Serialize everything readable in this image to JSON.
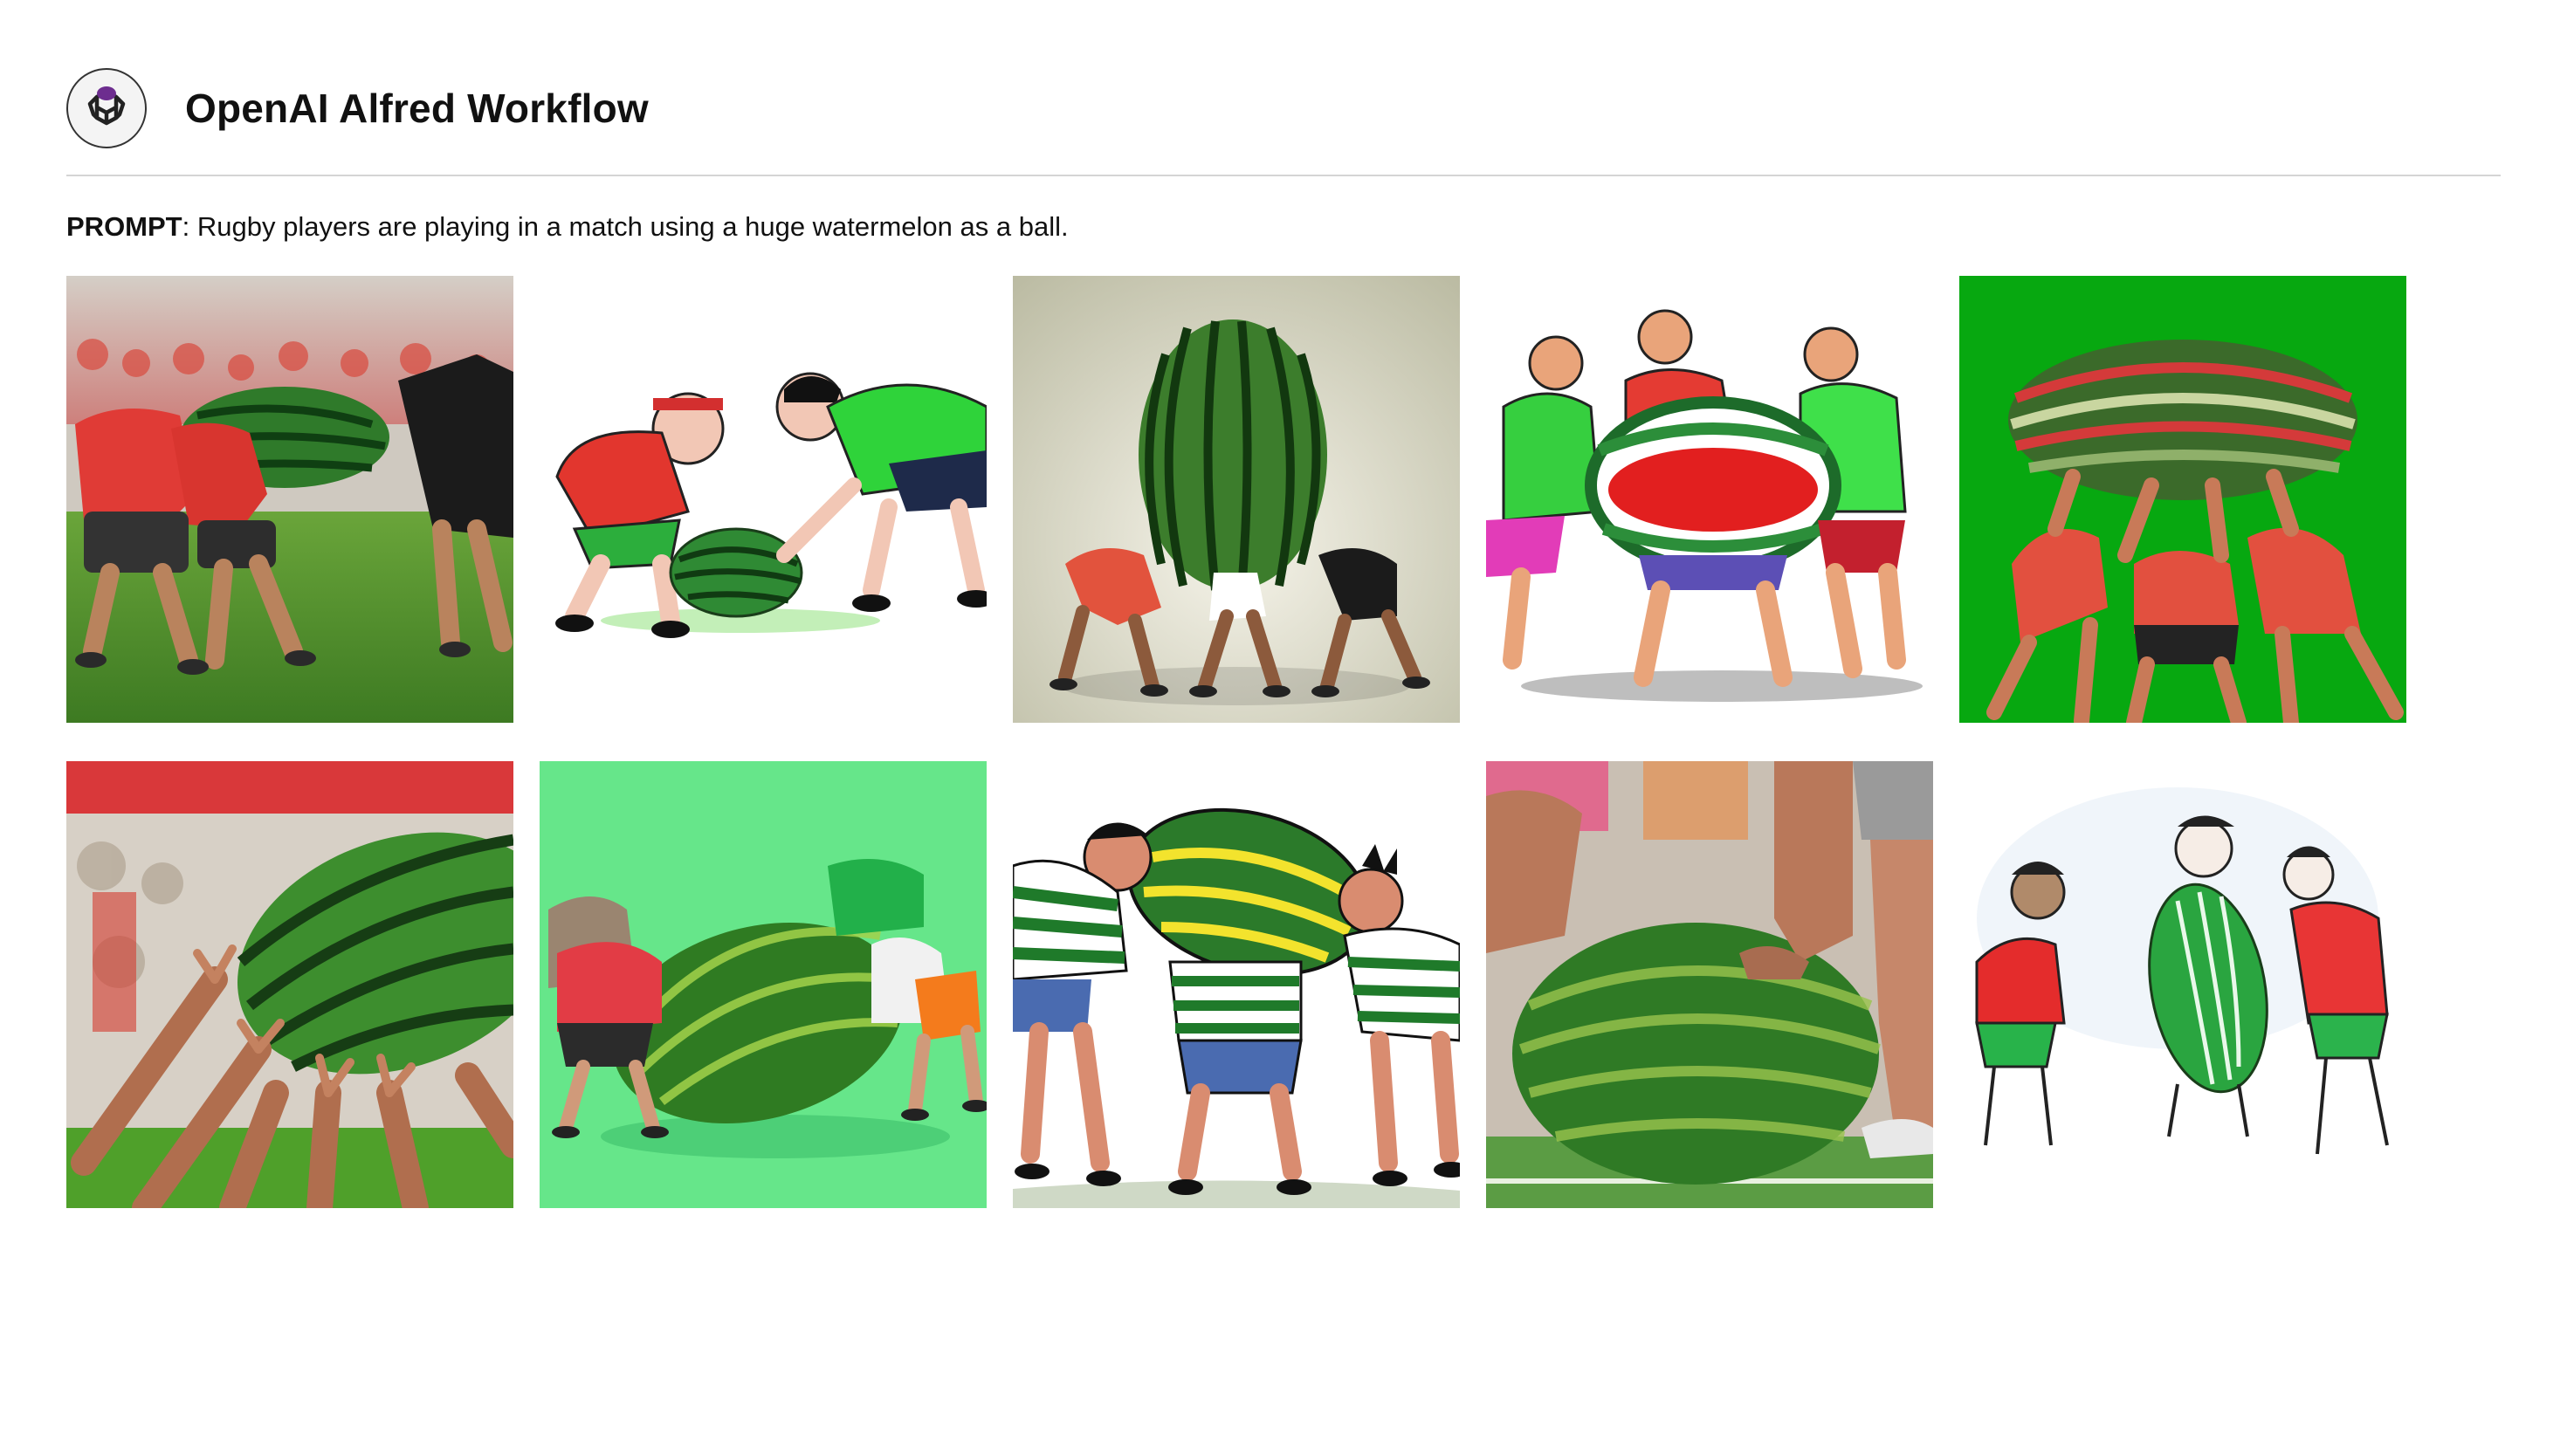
{
  "header": {
    "title": "OpenAI Alfred Workflow",
    "logo_icon": "openai-logo-icon"
  },
  "prompt": {
    "label": "PROMPT",
    "separator": ": ",
    "text": "Rugby players are playing in a match using a huge watermelon as a ball."
  },
  "images": [
    {
      "style": "photo",
      "subject": "players scrumming over large watermelon on grass, crowd behind"
    },
    {
      "style": "cartoon",
      "subject": "two cartoon players in red and green kits facing watermelon"
    },
    {
      "style": "render",
      "subject": "giant upright watermelon held by small players on grey backdrop"
    },
    {
      "style": "cartoon",
      "subject": "three cartoon players holding a red-striped watermelon"
    },
    {
      "style": "render",
      "subject": "players lifting an oval watermelon on bright green background"
    },
    {
      "style": "photo",
      "subject": "many hands holding up a watermelon, blurred crowd"
    },
    {
      "style": "render",
      "subject": "players pushing a huge watermelon on light green background"
    },
    {
      "style": "illustration",
      "subject": "players in striped jerseys wrestling over watermelon"
    },
    {
      "style": "photo",
      "subject": "close-up of hands and legs around watermelon on pitch"
    },
    {
      "style": "sketch",
      "subject": "hand-drawn players holding green watermelon"
    }
  ],
  "colors": {
    "watermelon_dark": "#1f5f1f",
    "watermelon_light": "#5aa032",
    "jersey_red": "#e23b2e",
    "jersey_green": "#2fd12f",
    "bg_green": "#07a810",
    "bg_mint": "#66e68a"
  }
}
